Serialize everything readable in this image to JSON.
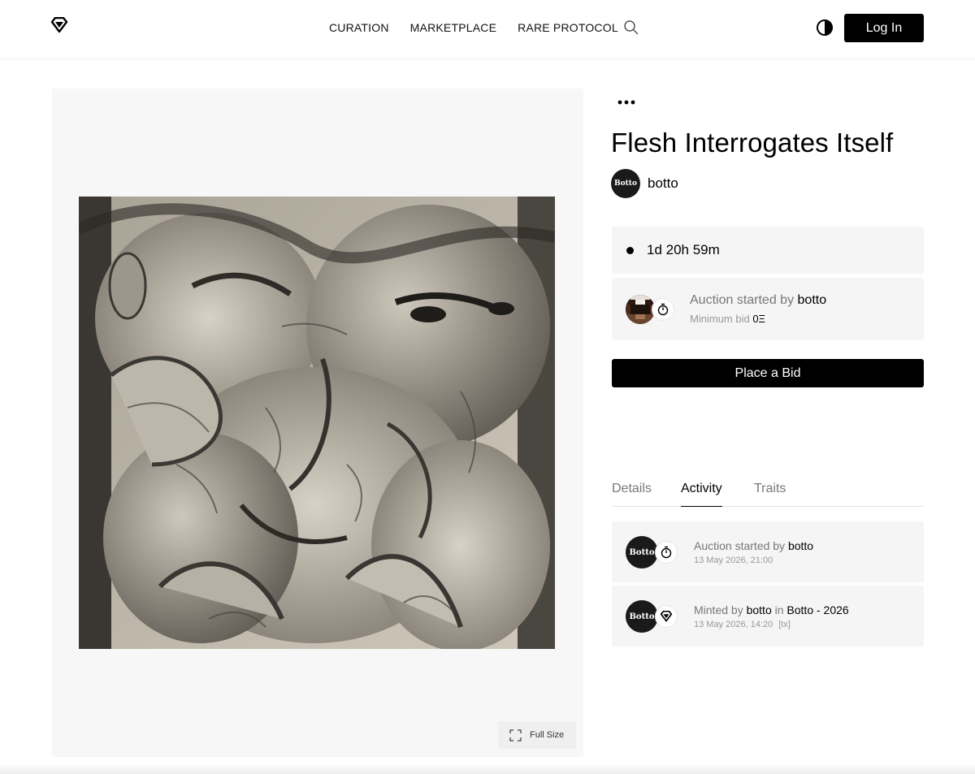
{
  "header": {
    "nav": [
      "CURATION",
      "MARKETPLACE",
      "RARE PROTOCOL"
    ],
    "login_label": "Log In",
    "icons": [
      "diamond-logo-icon",
      "search-icon",
      "contrast-icon"
    ]
  },
  "artwork": {
    "fullsize_label": "Full Size",
    "description": "Grayscale surreal drawing of distorted faces and hands"
  },
  "details": {
    "title": "Flesh Interrogates Itself",
    "artist": "botto",
    "avatar_text": "Botto",
    "timer": "1d 20h 59m",
    "auction_prefix": "Auction started by",
    "auction_by": "botto",
    "minimum_bid_label": "Minimum bid",
    "minimum_bid_value": "0Ξ",
    "bid_button": "Place a Bid"
  },
  "tabs": [
    {
      "label": "Details",
      "active": false
    },
    {
      "label": "Activity",
      "active": true
    },
    {
      "label": "Traits",
      "active": false
    }
  ],
  "activity": [
    {
      "prefix": "Auction started by",
      "user": "botto",
      "in_label": "",
      "collection": "",
      "date": "13 May 2026, 21:00",
      "tx": "",
      "badge_icon": "stopwatch-icon"
    },
    {
      "prefix": "Minted by",
      "user": "botto",
      "in_label": "in",
      "collection": "Botto - 2026",
      "date": "13 May 2026, 14:20",
      "tx": "[tx]",
      "badge_icon": "diamond-icon"
    }
  ],
  "colors": {
    "accent": "#000000",
    "card_bg": "#f5f5f5",
    "panel_bg": "#f7f7f7"
  }
}
